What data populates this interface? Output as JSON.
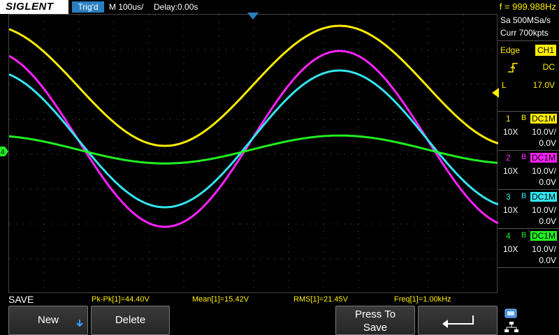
{
  "top_bar": {
    "logo": "SIGLENT",
    "trigger_state": "Trig'd",
    "timebase": "M 100us/",
    "delay": "Delay:0.00s",
    "frequency": "f = 999.988Hz"
  },
  "acquisition": {
    "sample_rate": "Sa 500MSa/s",
    "memory_depth": "Curr 700kpts"
  },
  "trigger": {
    "type": "Edge",
    "source": "CH1",
    "coupling": "DC",
    "level_label": "L",
    "level": "17.0V",
    "slope_icon": "rising-edge-icon"
  },
  "channels": [
    {
      "num": "1",
      "bw": "B",
      "coupling": "DC1M",
      "probe": "10X",
      "scale": "10.0V/",
      "offset": "0.0V",
      "color": "#ffee00"
    },
    {
      "num": "2",
      "bw": "B",
      "coupling": "DC1M",
      "probe": "10X",
      "scale": "10.0V/",
      "offset": "0.0V",
      "color": "#ff22ff"
    },
    {
      "num": "3",
      "bw": "B",
      "coupling": "DC1M",
      "probe": "10X",
      "scale": "10.0V/",
      "offset": "0.0V",
      "color": "#33e6f0"
    },
    {
      "num": "4",
      "bw": "B",
      "coupling": "DC1M",
      "probe": "10X",
      "scale": "10.0V/",
      "offset": "0.0V",
      "color": "#22ee22"
    }
  ],
  "ground_marker": "4",
  "menu_title": "SAVE",
  "measurements": [
    {
      "label": "Pk-Pk[1]=44.40V"
    },
    {
      "label": "Mean[1]=15.42V"
    },
    {
      "label": "RMS[1]=21.45V"
    },
    {
      "label": "Freq[1]=1.00kHz"
    }
  ],
  "softkeys": {
    "new": "New",
    "delete": "Delete",
    "press_to_save_line1": "Press To",
    "press_to_save_line2": "Save",
    "back_icon": "return-arrow-icon",
    "new_icon": "down-arrow-icon"
  },
  "status_icons": [
    "usb-icon",
    "network-icon"
  ],
  "colors": {
    "ch1": "#ffee00",
    "ch2": "#ff22ff",
    "ch3": "#33e6f0",
    "ch4": "#22ee22",
    "trig_status": "#2a7fbf"
  }
}
